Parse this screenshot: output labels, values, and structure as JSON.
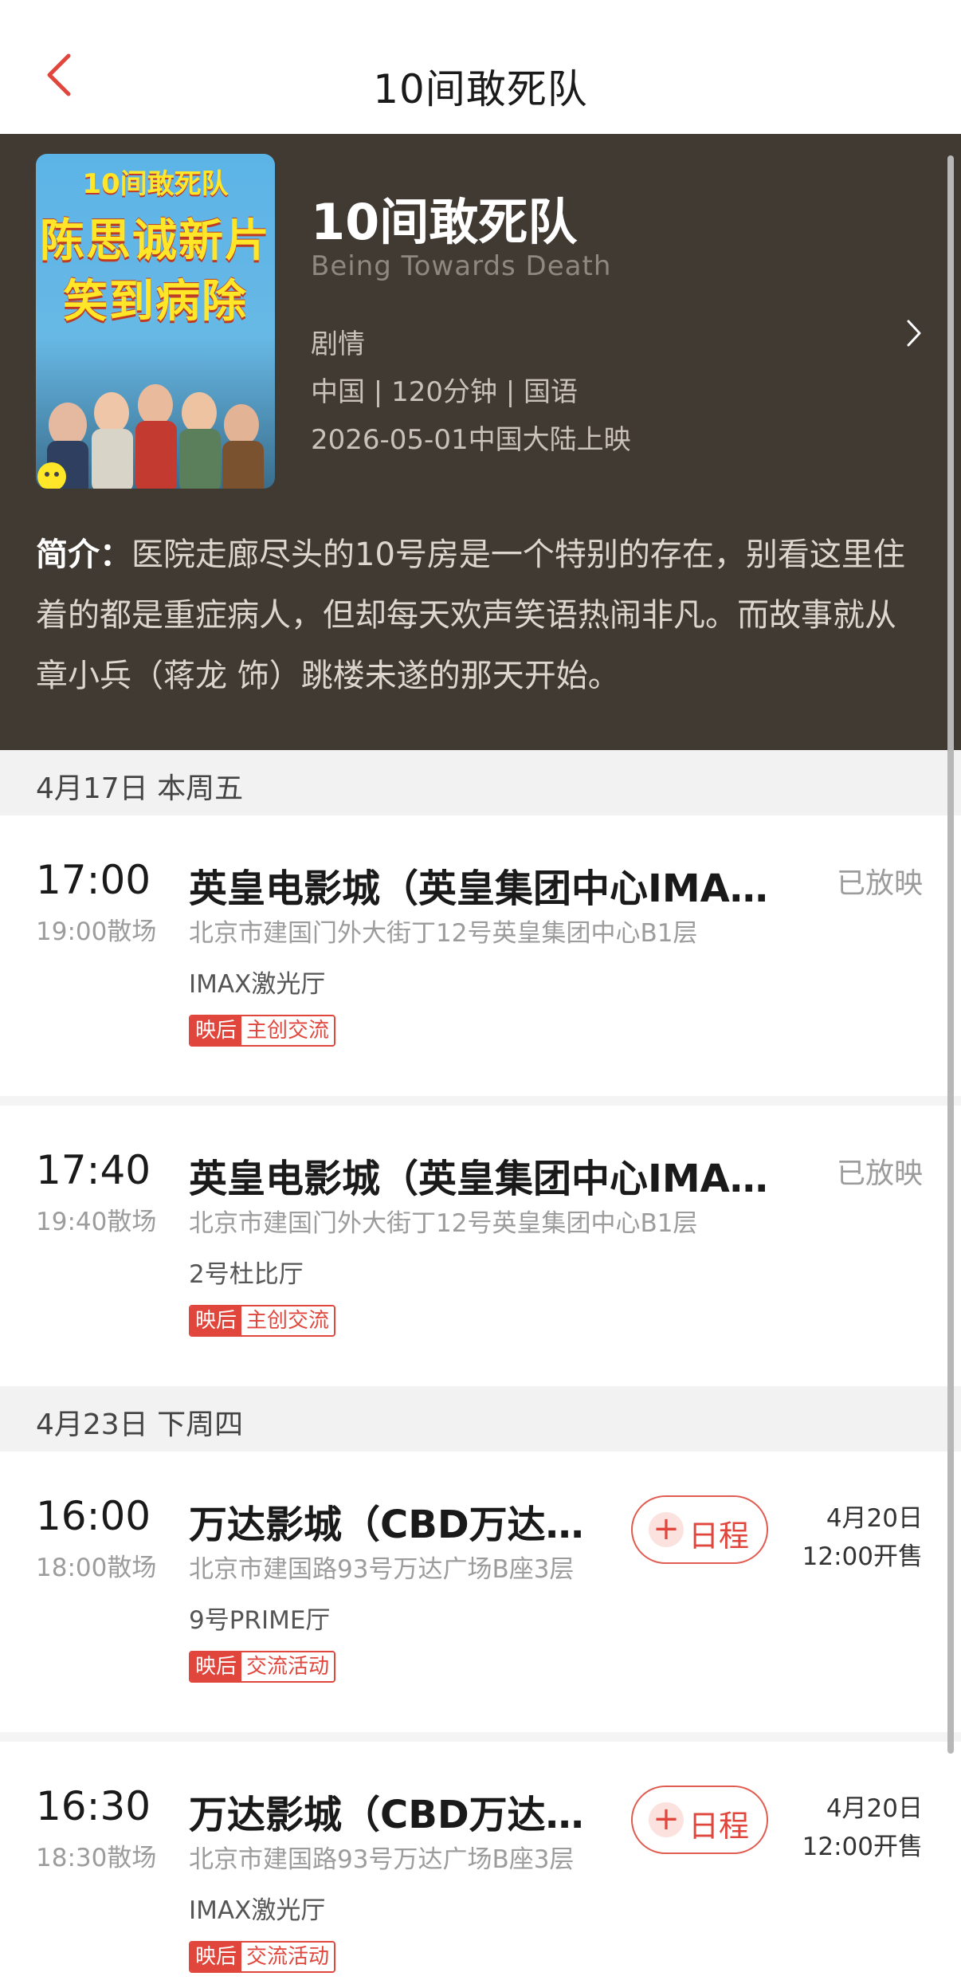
{
  "nav": {
    "title": "10间敢死队",
    "back_icon": "chevron-left-icon"
  },
  "movie": {
    "poster": {
      "title": "10间敢死队",
      "tagline_1": "陈思诚新片",
      "tagline_2": "笑到病除"
    },
    "title": "10间敢死队",
    "english_title": "Being Towards Death",
    "genre": "剧情",
    "meta": "中国 | 120分钟 | 国语",
    "release": "2026-05-01中国大陆上映",
    "synopsis_label": "简介：",
    "synopsis": "医院走廊尽头的10号房是一个特别的存在，别看这里住着的都是重症病人，但却每天欢声笑语热闹非凡。而故事就从章小兵（蒋龙 饰）跳楼未遂的那天开始。"
  },
  "dates": [
    {
      "label": "4月17日 本周五"
    },
    {
      "label": "4月23日 下周四"
    }
  ],
  "sessions": [
    {
      "time": "17:00",
      "end": "19:00散场",
      "cinema": "英皇电影城（英皇集团中心IMAX）",
      "address": "北京市建国门外大街丁12号英皇集团中心B1层",
      "hall": "IMAX激光厅",
      "tag_a": "映后",
      "tag_b": "主创交流",
      "status": "已放映"
    },
    {
      "time": "17:40",
      "end": "19:40散场",
      "cinema": "英皇电影城（英皇集团中心IMAX）",
      "address": "北京市建国门外大街丁12号英皇集团中心B1层",
      "hall": "2号杜比厅",
      "tag_a": "映后",
      "tag_b": "主创交流",
      "status": "已放映"
    },
    {
      "time": "16:00",
      "end": "18:00散场",
      "cinema": "万达影城（CBD万达广场店）",
      "address": "北京市建国路93号万达广场B座3层",
      "hall": "9号PRIME厅",
      "tag_a": "映后",
      "tag_b": "交流活动",
      "schedule_label": "日程",
      "sale_date": "4月20日",
      "sale_time": "12:00开售"
    },
    {
      "time": "16:30",
      "end": "18:30散场",
      "cinema": "万达影城（CBD万达广场店）",
      "address": "北京市建国路93号万达广场B座3层",
      "hall": "IMAX激光厅",
      "tag_a": "映后",
      "tag_b": "交流活动",
      "schedule_label": "日程",
      "sale_date": "4月20日",
      "sale_time": "12:00开售"
    }
  ],
  "colors": {
    "accent": "#e0463c",
    "header_bg": "#403a33",
    "muted": "#9c9c9c"
  }
}
